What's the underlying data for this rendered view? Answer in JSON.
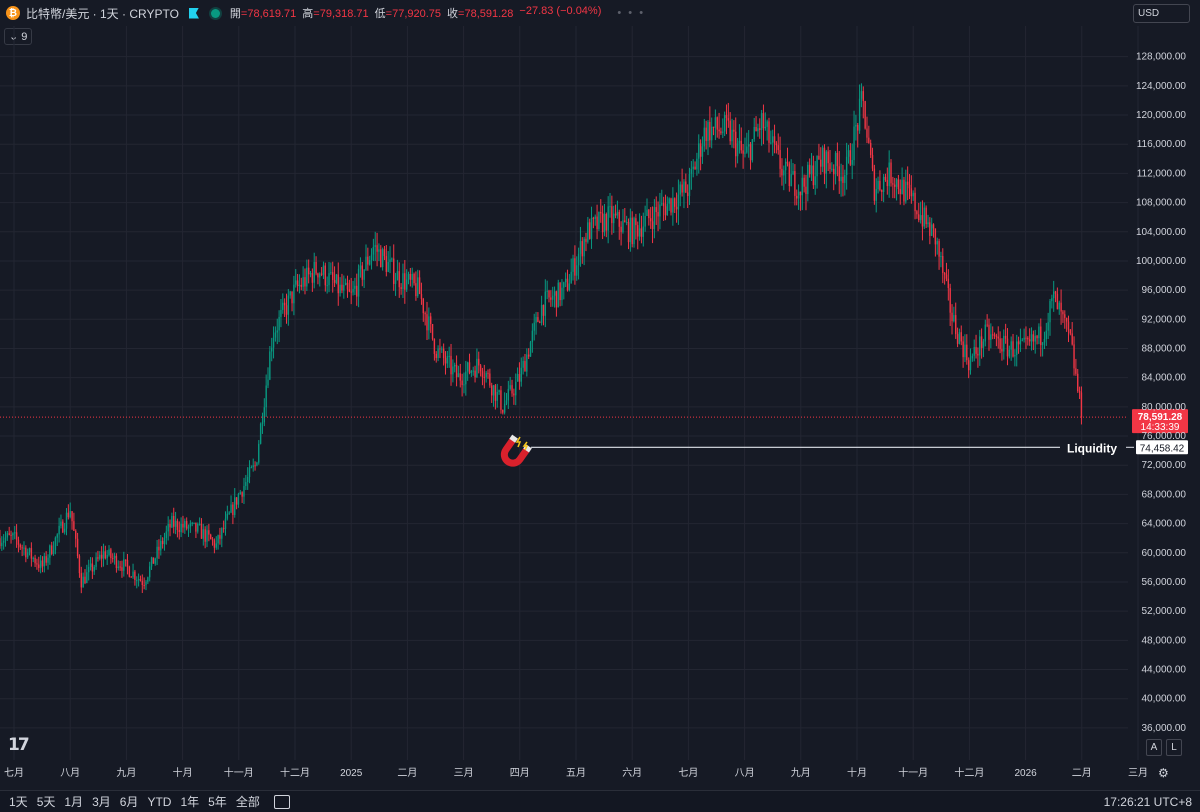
{
  "header": {
    "symbol": "比特幣/美元 · 1天 · CRYPTO",
    "open_label": "開",
    "open": "=78,619.71",
    "high_label": "高",
    "high": "=79,318.71",
    "low_label": "低",
    "low": "=77,920.75",
    "close_label": "收",
    "close": "=78,591.28",
    "change": "−27.83 (−0.04%)",
    "indicators_count": "9",
    "currency": "USD"
  },
  "colors": {
    "up": "#089981",
    "down": "#f23645",
    "background": "#161a25",
    "grid": "#232632"
  },
  "chart_data": {
    "type": "candlestick",
    "y_tick_labels": [
      "128,000.00",
      "124,000.00",
      "120,000.00",
      "116,000.00",
      "112,000.00",
      "108,000.00",
      "104,000.00",
      "100,000.00",
      "96,000.00",
      "92,000.00",
      "88,000.00",
      "84,000.00",
      "80,000.00",
      "76,000.00",
      "72,000.00",
      "68,000.00",
      "64,000.00",
      "60,000.00",
      "56,000.00",
      "52,000.00",
      "48,000.00",
      "44,000.00",
      "40,000.00",
      "36,000.00"
    ],
    "y_ticks": [
      128000,
      124000,
      120000,
      116000,
      112000,
      108000,
      104000,
      100000,
      96000,
      92000,
      88000,
      84000,
      80000,
      76000,
      72000,
      68000,
      64000,
      60000,
      56000,
      52000,
      48000,
      44000,
      40000,
      36000
    ],
    "x_tick_labels": [
      "七月",
      "八月",
      "九月",
      "十月",
      "十一月",
      "十二月",
      "2025",
      "二月",
      "三月",
      "四月",
      "五月",
      "六月",
      "七月",
      "八月",
      "九月",
      "十月",
      "十一月",
      "十二月",
      "2026",
      "二月",
      "三月"
    ],
    "ylim": [
      31600,
      132200
    ],
    "price_line": {
      "value": 78591.28,
      "label": "78,591.28",
      "countdown": "14:33:39"
    },
    "liquidity_line": {
      "value": 74458.42,
      "label": "74,458.42",
      "annotation": "Liquidity"
    },
    "anchors": [
      {
        "month": 0,
        "price": 62000
      },
      {
        "month": 0.5,
        "price": 58000
      },
      {
        "month": 1,
        "price": 66000
      },
      {
        "month": 1.2,
        "price": 56000
      },
      {
        "month": 1.6,
        "price": 60000
      },
      {
        "month": 2,
        "price": 58000
      },
      {
        "month": 2.3,
        "price": 56000
      },
      {
        "month": 2.8,
        "price": 64000
      },
      {
        "month": 3.3,
        "price": 63000
      },
      {
        "month": 3.6,
        "price": 61000
      },
      {
        "month": 4,
        "price": 68000
      },
      {
        "month": 4.3,
        "price": 72000
      },
      {
        "month": 4.6,
        "price": 90000
      },
      {
        "month": 5,
        "price": 96000
      },
      {
        "month": 5.4,
        "price": 99000
      },
      {
        "month": 5.8,
        "price": 96000
      },
      {
        "month": 6,
        "price": 95000
      },
      {
        "month": 6.4,
        "price": 102000
      },
      {
        "month": 6.8,
        "price": 98000
      },
      {
        "month": 7.2,
        "price": 96000
      },
      {
        "month": 7.5,
        "price": 88000
      },
      {
        "month": 7.9,
        "price": 84000
      },
      {
        "month": 8.3,
        "price": 86000
      },
      {
        "month": 8.7,
        "price": 80000
      },
      {
        "month": 9,
        "price": 84000
      },
      {
        "month": 9.4,
        "price": 94000
      },
      {
        "month": 9.8,
        "price": 96000
      },
      {
        "month": 10.2,
        "price": 104000
      },
      {
        "month": 10.6,
        "price": 106000
      },
      {
        "month": 11,
        "price": 104000
      },
      {
        "month": 11.5,
        "price": 107000
      },
      {
        "month": 12,
        "price": 110000
      },
      {
        "month": 12.3,
        "price": 118000
      },
      {
        "month": 12.7,
        "price": 118000
      },
      {
        "month": 13,
        "price": 114000
      },
      {
        "month": 13.3,
        "price": 119000
      },
      {
        "month": 13.7,
        "price": 112000
      },
      {
        "month": 14,
        "price": 110000
      },
      {
        "month": 14.4,
        "price": 114000
      },
      {
        "month": 14.8,
        "price": 112000
      },
      {
        "month": 15.1,
        "price": 122000
      },
      {
        "month": 15.3,
        "price": 110000
      },
      {
        "month": 15.6,
        "price": 112000
      },
      {
        "month": 16,
        "price": 108000
      },
      {
        "month": 16.4,
        "price": 103000
      },
      {
        "month": 16.7,
        "price": 92000
      },
      {
        "month": 17,
        "price": 86000
      },
      {
        "month": 17.3,
        "price": 90000
      },
      {
        "month": 17.7,
        "price": 88000
      },
      {
        "month": 18,
        "price": 88000
      },
      {
        "month": 18.3,
        "price": 90000
      },
      {
        "month": 18.5,
        "price": 95000
      },
      {
        "month": 18.8,
        "price": 89000
      },
      {
        "month": 19,
        "price": 78600
      }
    ]
  },
  "bottom_bar": {
    "ranges": [
      "1天",
      "5天",
      "1月",
      "3月",
      "6月",
      "YTD",
      "1年",
      "5年",
      "全部"
    ],
    "clock": "17:26:21 UTC+8"
  },
  "scale_buttons": {
    "auto": "A",
    "log": "L"
  },
  "logo_text": "17"
}
